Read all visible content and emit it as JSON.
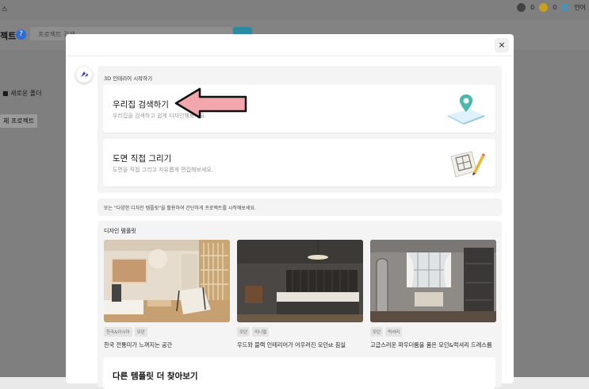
{
  "background": {
    "tab_label": "스",
    "coins": [
      {
        "value": "0",
        "color": "#444444"
      },
      {
        "value": "0",
        "color": "#c8a020"
      }
    ],
    "lang_label": "언어",
    "page_title": "젝트",
    "help_icon": "?",
    "search_placeholder": "프로젝트 검색",
    "new_folder": "새로운 폴더",
    "all_projects": "체 프로젝트"
  },
  "modal": {
    "close_icon": "×",
    "start_label": "3D 인테리어 시작하기",
    "cards": [
      {
        "title": "우리집 검색하기",
        "desc": "우리집을 검색하고 쉽게 디자인해보세요.",
        "icon": "map-pin-icon"
      },
      {
        "title": "도면 직접 그리기",
        "desc": "도면을 직접 그리고 자유롭게 편집해보세요.",
        "icon": "floorplan-pencil-icon"
      }
    ],
    "note": "또는 \"다양한 디자인 템플릿\"을 활용하여 간단하게 프로젝트를 시작해보세요.",
    "templates_label": "디자인 템플릿",
    "templates": [
      {
        "tags": [
          "한국&아시아",
          "모던"
        ],
        "name": "한국 전통미가 느껴지는 공간"
      },
      {
        "tags": [
          "모던",
          "미니멀"
        ],
        "name": "우드와 블랙 인테리어가 어우러진 모던st 침실"
      },
      {
        "tags": [
          "모던",
          "럭셔리"
        ],
        "name": "고급스러운 파우더룸을 품은 모던&럭셔리 드레스룸"
      }
    ],
    "more_title": "다른 템플릿 더 찾아보기"
  }
}
